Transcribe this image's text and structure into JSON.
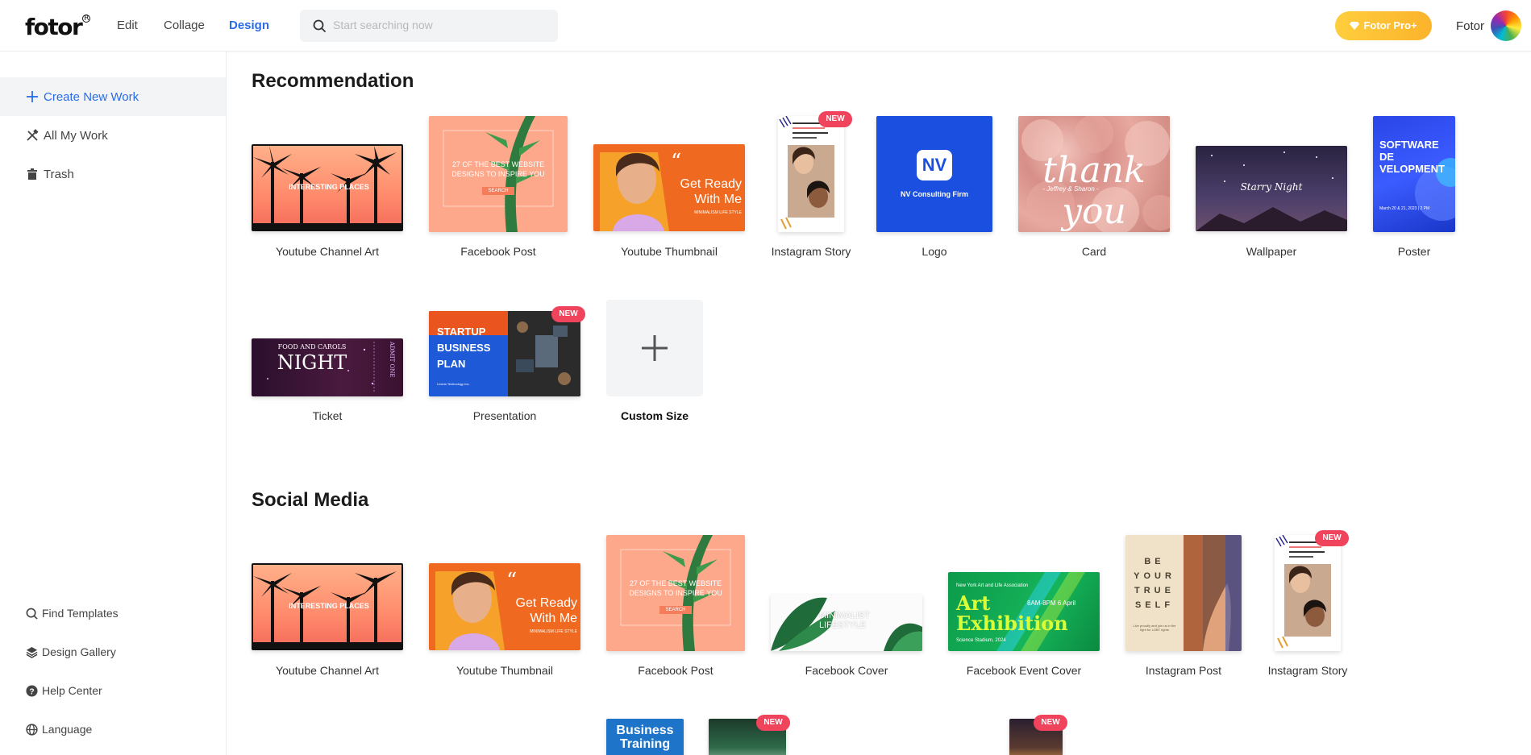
{
  "header": {
    "logo": "fotor",
    "nav": [
      "Edit",
      "Collage",
      "Design"
    ],
    "active_nav": "Design",
    "search_placeholder": "Start searching now",
    "pro_button": "Fotor Pro+",
    "user_name": "Fotor"
  },
  "sidebar": {
    "items": [
      {
        "label": "Create New Work",
        "icon": "plus-icon"
      },
      {
        "label": "All My Work",
        "icon": "tools-icon"
      },
      {
        "label": "Trash",
        "icon": "trash-icon"
      }
    ],
    "footer": [
      {
        "label": "Find Templates",
        "icon": "search-icon"
      },
      {
        "label": "Design Gallery",
        "icon": "layers-icon"
      },
      {
        "label": "Help Center",
        "icon": "help-icon"
      },
      {
        "label": "Language",
        "icon": "globe-icon"
      }
    ]
  },
  "recommendation": {
    "title": "Recommendation",
    "cards": [
      {
        "label": "Youtube Channel Art",
        "thumb_text": "INTERESTING PLACES"
      },
      {
        "label": "Facebook Post",
        "thumb_text": "27 OF THE BEST WEBSITE DESIGNS TO INSPIRE YOU",
        "thumb_sub": "SEARCH"
      },
      {
        "label": "Youtube Thumbnail",
        "thumb_text": "Get Ready With Me",
        "thumb_sub": "MINIMALISM LIFE STYLE"
      },
      {
        "label": "Instagram Story",
        "badge": "NEW",
        "thumb_text": "Welcome to our brand community"
      },
      {
        "label": "Logo",
        "thumb_text": "NV",
        "thumb_sub": "NV Consulting Firm"
      },
      {
        "label": "Card",
        "thumb_text": "thank you",
        "thumb_sub": "- Jeffrey & Sharon -"
      },
      {
        "label": "Wallpaper",
        "thumb_text": "Starry Night"
      },
      {
        "label": "Poster",
        "thumb_text": "SOFTWARE DE VELOPMENT",
        "thumb_sub": "March 20 & 21, 2023 | 2 PM"
      },
      {
        "label": "Ticket",
        "thumb_text": "NIGHT",
        "thumb_sub": "FOOD AND CAROLS",
        "thumb_side": "ADMIT ONE"
      },
      {
        "label": "Presentation",
        "badge": "NEW",
        "thumb_text": "STARTUP BUSINESS PLAN",
        "thumb_sub": "Liceria Technology Inc."
      },
      {
        "label": "Custom Size"
      }
    ]
  },
  "social_media": {
    "title": "Social Media",
    "cards": [
      {
        "label": "Youtube Channel Art",
        "thumb_text": "INTERESTING PLACES"
      },
      {
        "label": "Youtube Thumbnail",
        "thumb_text": "Get Ready With Me",
        "thumb_sub": "MINIMALISM LIFE STYLE"
      },
      {
        "label": "Facebook Post",
        "thumb_text": "27 OF THE BEST WEBSITE DESIGNS TO INSPIRE YOU",
        "thumb_sub": "SEARCH"
      },
      {
        "label": "Facebook Cover",
        "thumb_text": "MINIMALIST LIFESTYLE"
      },
      {
        "label": "Facebook Event Cover",
        "thumb_text": "Art Exhibition",
        "thumb_sub": "New York Art and Life Association",
        "thumb_time": "8AM-8PM 6 April",
        "thumb_place": "Science Stadium, 2024"
      },
      {
        "label": "Instagram Post",
        "thumb_text": "BE YOUR TRUE SELF",
        "thumb_sub": "Live proudly and join us in the fight for LGBT rights"
      },
      {
        "label": "Instagram Story",
        "badge": "NEW",
        "thumb_text": "Welcome to our brand community"
      }
    ],
    "partial_cards": [
      {
        "thumb_text": "Business Training"
      },
      {
        "badge": "NEW"
      },
      {
        "badge": "NEW"
      }
    ]
  },
  "colors": {
    "accent": "#2a6ce6",
    "badge": "#f0435c",
    "pro": "#fbb32c"
  }
}
